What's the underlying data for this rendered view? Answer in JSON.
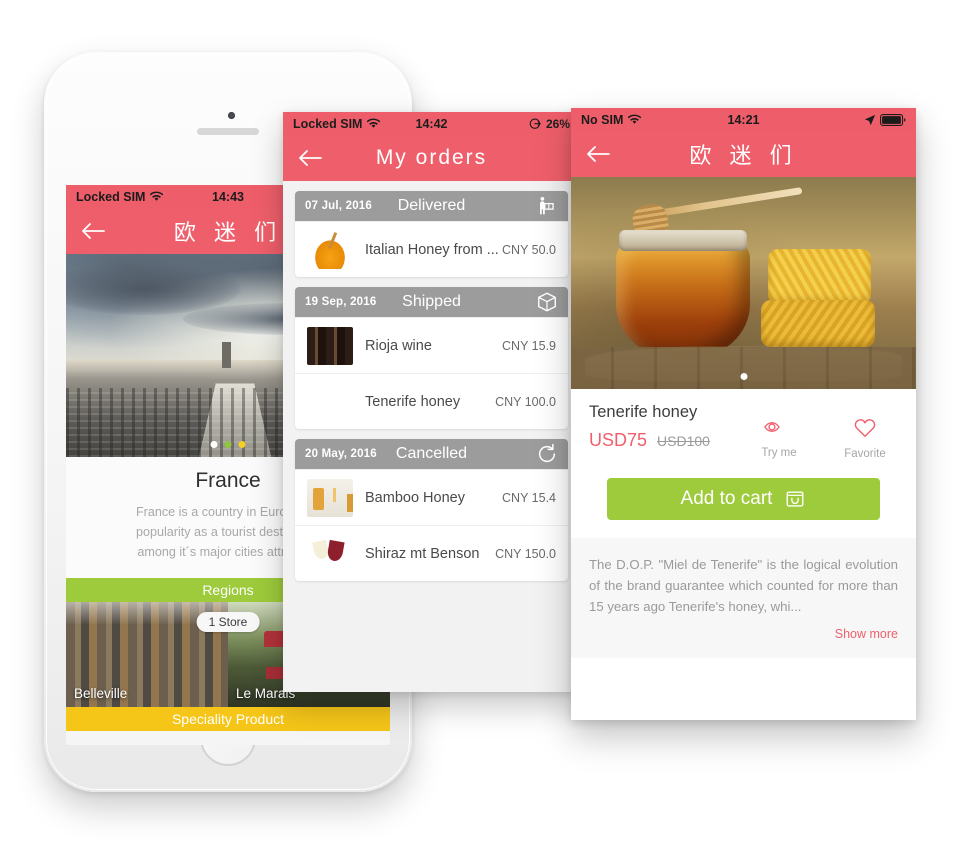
{
  "phone1": {
    "statusbar": {
      "carrier": "Locked SIM",
      "wifi": "wifi-icon",
      "time": "14:43"
    },
    "navbar": {
      "title": "欧 迷 们",
      "back": "back-arrow-icon"
    },
    "hero": {
      "alt": "paris-cityscape"
    },
    "country": {
      "title": "France",
      "description_lines": [
        "France is a country in Europe wh",
        "popularity as a tourist destination",
        "among it´s major cities attraction"
      ]
    },
    "sections": {
      "regions_label": "Regions",
      "speciality_label": "Speciality Product"
    },
    "regions": [
      {
        "name": "Belleville",
        "badge": "1 Store"
      },
      {
        "name": "Le Marais",
        "badge": ""
      }
    ]
  },
  "phone2": {
    "statusbar": {
      "carrier": "Locked SIM",
      "wifi": "wifi-icon",
      "time": "14:42",
      "battery": "26%",
      "battery_icon": "charging-icon"
    },
    "navbar": {
      "title": "My orders",
      "back": "back-arrow-icon"
    },
    "orders": [
      {
        "date": "07 Jul, 2016",
        "status": "Delivered",
        "icon": "delivery-person-icon",
        "items": [
          {
            "name": "Italian Honey from ...",
            "price": "CNY 50.0",
            "thumb": "honey-jar-thumb"
          }
        ]
      },
      {
        "date": "19 Sep, 2016",
        "status": "Shipped",
        "icon": "package-box-icon",
        "items": [
          {
            "name": "Rioja wine",
            "price": "CNY 15.9",
            "thumb": "wine-bottles-thumb"
          },
          {
            "name": "Tenerife honey",
            "price": "CNY 100.0",
            "thumb": "tenerife-honey-thumb"
          }
        ]
      },
      {
        "date": "20 May, 2016",
        "status": "Cancelled",
        "icon": "refresh-arrow-icon",
        "items": [
          {
            "name": "Bamboo Honey",
            "price": "CNY 15.4",
            "thumb": "bamboo-honey-thumb"
          },
          {
            "name": "Shiraz mt Benson",
            "price": "CNY 150.0",
            "thumb": "wine-glasses-thumb"
          }
        ]
      }
    ]
  },
  "phone3": {
    "statusbar": {
      "carrier": "No SIM",
      "wifi": "wifi-icon",
      "time": "14:21",
      "location": "location-arrow-icon",
      "battery_icon": "battery-full-icon"
    },
    "navbar": {
      "title": "欧 迷 们",
      "back": "back-arrow-icon"
    },
    "hero": {
      "alt": "honey-jar-with-honeycomb"
    },
    "product": {
      "name": "Tenerife honey",
      "price": "USD75",
      "old_price": "USD100",
      "try_me_label": "Try me",
      "favorite_label": "Favorite",
      "add_to_cart_label": "Add to cart",
      "description": "The D.O.P. \"Miel de Tenerife\" is the logical evolution of the brand guarantee which counted for more than 15 years ago Tenerife's honey, whi...",
      "show_more_label": "Show more"
    }
  },
  "colors": {
    "coral": "#ee5e6a",
    "green": "#9dcb3b",
    "yellow": "#f5c518",
    "grey_header": "#9c9c9c"
  }
}
